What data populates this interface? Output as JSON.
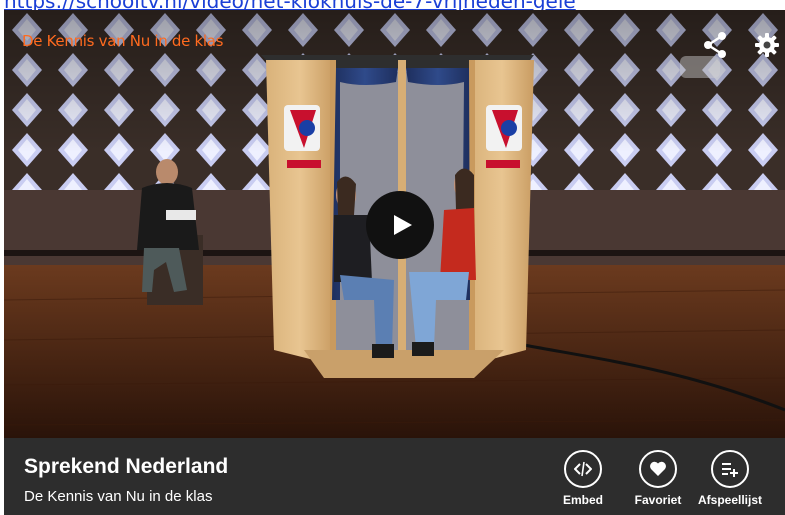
{
  "page": {
    "top_link": "https://schooltv.nl/video/het-klokhuis-de-7-vrijheden-gele"
  },
  "player": {
    "brand_label": "De Kennis van Nu in de klas",
    "brand_color": "#ff6a1f",
    "icons": {
      "share": "share-icon",
      "settings": "gear-icon",
      "play": "play-icon"
    }
  },
  "video": {
    "title": "Sprekend Nederland",
    "subtitle": "De Kennis van Nu in de klas"
  },
  "actions": [
    {
      "label": "Embed",
      "icon": "code-icon"
    },
    {
      "label": "Favoriet",
      "icon": "heart-icon"
    },
    {
      "label": "Afspeellijst",
      "icon": "playlist-add-icon"
    }
  ]
}
